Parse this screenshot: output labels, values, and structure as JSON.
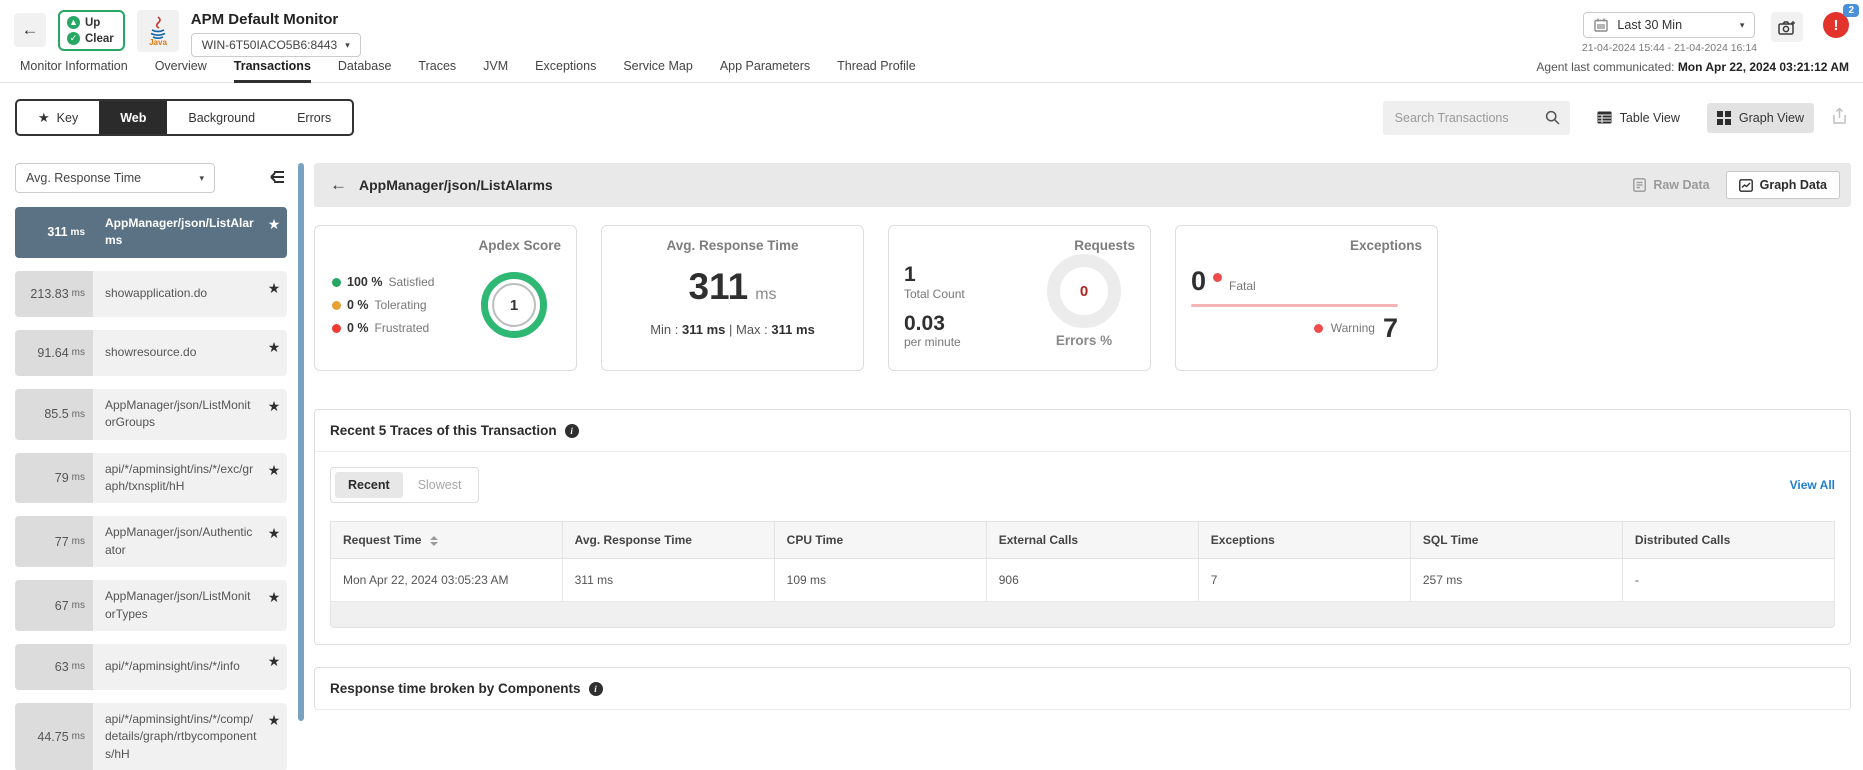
{
  "header": {
    "status_up": "Up",
    "status_clear": "Clear",
    "java_label": "Java",
    "title": "APM Default Monitor",
    "monitor_host": "WIN-6T50IACO5B6:8443",
    "time_range": "Last 30 Min",
    "time_range_detail": "21-04-2024 15:44 - 21-04-2024 16:14",
    "alert_count": "2",
    "agent_label": "Agent last communicated:",
    "agent_value": "Mon Apr 22, 2024 03:21:12 AM"
  },
  "tabs": {
    "items": [
      "Monitor Information",
      "Overview",
      "Transactions",
      "Database",
      "Traces",
      "JVM",
      "Exceptions",
      "Service Map",
      "App Parameters",
      "Thread Profile"
    ],
    "active": "Transactions"
  },
  "subtabs": {
    "key": "Key",
    "web": "Web",
    "background": "Background",
    "errors": "Errors",
    "active": "Web"
  },
  "toolbar": {
    "search_placeholder": "Search Transactions",
    "table_view": "Table View",
    "graph_view": "Graph View"
  },
  "sidebar": {
    "metric_filter": "Avg. Response Time",
    "items": [
      {
        "value": "311",
        "unit": "ms",
        "name": "AppManager/json/ListAlarms",
        "selected": true
      },
      {
        "value": "213.83",
        "unit": "ms",
        "name": "showapplication.do",
        "selected": false
      },
      {
        "value": "91.64",
        "unit": "ms",
        "name": "showresource.do",
        "selected": false
      },
      {
        "value": "85.5",
        "unit": "ms",
        "name": "AppManager/json/ListMonitorGroups",
        "selected": false
      },
      {
        "value": "79",
        "unit": "ms",
        "name": "api/*/apminsight/ins/*/exc/graph/txnsplit/hH",
        "selected": false
      },
      {
        "value": "77",
        "unit": "ms",
        "name": "AppManager/json/Authenticator",
        "selected": false
      },
      {
        "value": "67",
        "unit": "ms",
        "name": "AppManager/json/ListMonitorTypes",
        "selected": false
      },
      {
        "value": "63",
        "unit": "ms",
        "name": "api/*/apminsight/ins/*/info",
        "selected": false
      },
      {
        "value": "44.75",
        "unit": "ms",
        "name": "api/*/apminsight/ins/*/comp/details/graph/rtbycomponents/hH",
        "selected": false
      }
    ]
  },
  "main": {
    "transaction_title": "AppManager/json/ListAlarms",
    "raw_data_label": "Raw Data",
    "graph_data_label": "Graph Data",
    "cards": {
      "apdex": {
        "title": "Apdex Score",
        "score": "1",
        "legend": [
          {
            "pct": "100 %",
            "label": "Satisfied"
          },
          {
            "pct": "0 %",
            "label": "Tolerating"
          },
          {
            "pct": "0 %",
            "label": "Frustrated"
          }
        ]
      },
      "avg_response": {
        "title": "Avg. Response Time",
        "value": "311",
        "unit": "ms",
        "min_label": "Min :",
        "min": "311 ms",
        "sep": "|",
        "max_label": "Max :",
        "max": "311 ms"
      },
      "requests": {
        "title": "Requests",
        "total": "1",
        "total_label": "Total Count",
        "rate": "0.03",
        "rate_label": "per minute",
        "errors": "0",
        "errors_label": "Errors %"
      },
      "exceptions": {
        "title": "Exceptions",
        "fatal": "0",
        "fatal_label": "Fatal",
        "warning_label": "Warning",
        "warning": "7"
      }
    },
    "traces": {
      "title": "Recent 5 Traces of this Transaction",
      "recent": "Recent",
      "slowest": "Slowest",
      "view_all": "View All",
      "headers": [
        "Request Time",
        "Avg. Response Time",
        "CPU Time",
        "External Calls",
        "Exceptions",
        "SQL Time",
        "Distributed Calls"
      ],
      "row": [
        "Mon Apr 22, 2024 03:05:23 AM",
        "311 ms",
        "109 ms",
        "906",
        "7",
        "257 ms",
        "-"
      ]
    },
    "components": {
      "title": "Response time broken by Components"
    }
  },
  "colors": {
    "green": "#27a763",
    "apdex_ring_green": "#2eb873",
    "selected_row": "#5a7284",
    "scrollbar_thumb": "#79a1c0",
    "alert_red": "#e2342c",
    "badge_blue": "#4a90d9",
    "link_blue": "#1f7ed0",
    "tolerating_orange": "#e5a232",
    "frustrated_red": "#ee3c35",
    "errors_value_red": "#b3231f"
  }
}
